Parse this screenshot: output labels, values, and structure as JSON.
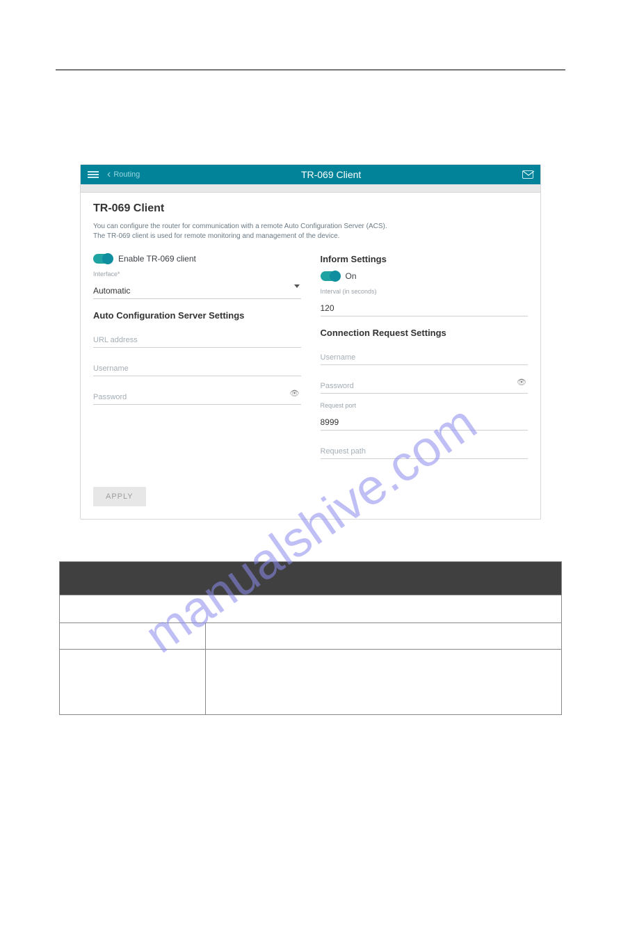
{
  "header": {
    "back_label": "Routing",
    "title": "TR-069 Client"
  },
  "page": {
    "title": "TR-069 Client",
    "description_line1": "You can configure the router for communication with a remote Auto Configuration Server (ACS).",
    "description_line2": "The TR-069 client is used for remote monitoring and management of the device."
  },
  "left_panel": {
    "enable_toggle_label": "Enable TR-069 client",
    "interface_label": "Interface*",
    "interface_value": "Automatic",
    "acs_section_title": "Auto Configuration Server Settings",
    "url_placeholder": "URL address",
    "username_placeholder": "Username",
    "password_placeholder": "Password"
  },
  "right_panel": {
    "inform_section_title": "Inform Settings",
    "on_label": "On",
    "interval_small_label": "Interval (in seconds)",
    "interval_value": "120",
    "cr_section_title": "Connection Request Settings",
    "username_placeholder": "Username",
    "password_placeholder": "Password",
    "port_small_label": "Request port",
    "port_value": "8999",
    "path_placeholder": "Request path"
  },
  "buttons": {
    "apply": "APPLY"
  },
  "watermark": "manualshive.com"
}
